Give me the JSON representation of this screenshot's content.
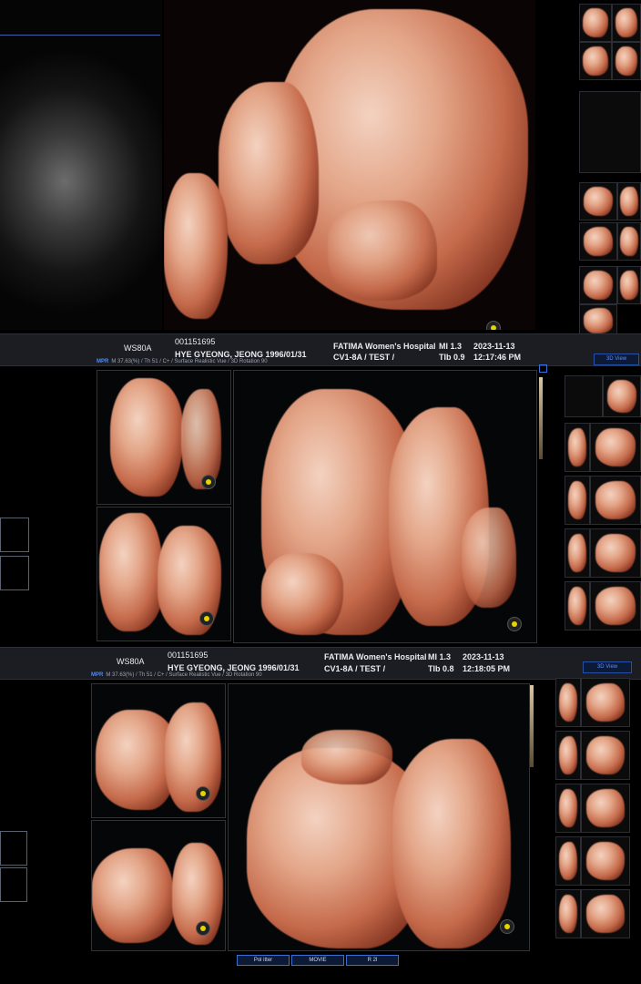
{
  "panel1": {
    "system": "WS80A",
    "patient_id": "001151695",
    "patient_name": "HYE GYEONG, JEONG 1996/01/31",
    "hospital": "FATIMA Women's Hospital",
    "probe": "CV1-8A / TEST /",
    "mi": "MI  1.3",
    "tib": "TIb 0.9",
    "date": "2023-11-13",
    "time": "12:17:46 PM",
    "view_tab": "3D View",
    "mpr_label": "MPR",
    "mpr_info": "M 37.63(%) / Th 51 / C+ / Surface Realistic Vue / 3D Rotation 90"
  },
  "panel2": {
    "system": "WS80A",
    "patient_id": "001151695",
    "patient_name": "HYE GYEONG, JEONG 1996/01/31",
    "hospital": "FATIMA Women's Hospital",
    "probe": "CV1-8A / TEST /",
    "mi": "MI  1.3",
    "tib": "TIb 0.8",
    "date": "2023-11-13",
    "time": "12:18:05 PM",
    "view_tab": "3D View",
    "mpr_label": "MPR",
    "mpr_info": "M 37.63(%) / Th 51 / C+ / Surface Realistic Vue / 3D Rotation 90"
  },
  "bottom_buttons": [
    "Pol itter",
    "MOVIE",
    "R 2l"
  ],
  "colors": {
    "accent_blue": "#2f6bff",
    "marker_yellow": "#e6d400",
    "info_bar": "#1b1d22"
  },
  "icons": [
    "cursor-marker-icon",
    "3d-view-icon"
  ]
}
